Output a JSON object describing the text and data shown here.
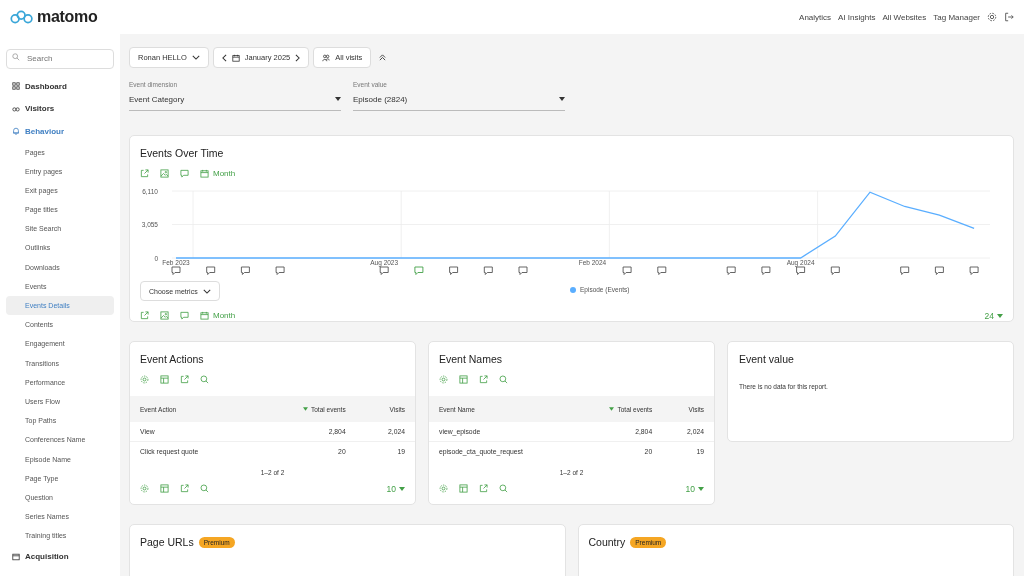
{
  "header": {
    "logo": "matomo",
    "nav": [
      "Analytics",
      "AI Insights",
      "All Websites",
      "Tag Manager"
    ]
  },
  "sidebar": {
    "search_placeholder": "Search",
    "sections": [
      {
        "label": "Dashboard",
        "kind": "grid",
        "selected": false
      },
      {
        "label": "Visitors",
        "kind": "glasses",
        "selected": false
      },
      {
        "label": "Behaviour",
        "kind": "bell",
        "selected": true,
        "children": [
          {
            "label": "Pages",
            "selected": false
          },
          {
            "label": "Entry pages",
            "selected": false
          },
          {
            "label": "Exit pages",
            "selected": false
          },
          {
            "label": "Page titles",
            "selected": false
          },
          {
            "label": "Site Search",
            "selected": false
          },
          {
            "label": "Outlinks",
            "selected": false
          },
          {
            "label": "Downloads",
            "selected": false
          },
          {
            "label": "Events",
            "selected": false
          },
          {
            "label": "Events Details",
            "selected": true
          },
          {
            "label": "Contents",
            "selected": false
          },
          {
            "label": "Engagement",
            "selected": false
          },
          {
            "label": "Transitions",
            "selected": false
          },
          {
            "label": "Performance",
            "selected": false
          },
          {
            "label": "Users Flow",
            "selected": false
          },
          {
            "label": "Top Paths",
            "selected": false
          },
          {
            "label": "Conferences Name",
            "selected": false
          },
          {
            "label": "Episode Name",
            "selected": false
          },
          {
            "label": "Page Type",
            "selected": false
          },
          {
            "label": "Question",
            "selected": false
          },
          {
            "label": "Series Names",
            "selected": false
          },
          {
            "label": "Training titles",
            "selected": false
          }
        ]
      },
      {
        "label": "Acquisition",
        "kind": "window",
        "selected": false
      }
    ]
  },
  "filters": {
    "site": "Ronan HELLO",
    "period": "January 2025",
    "segment": "All visits"
  },
  "dimension_fields": [
    {
      "label": "Event dimension",
      "value": "Event Category"
    },
    {
      "label": "Event value",
      "value": "Episode (2824)"
    }
  ],
  "evolution": {
    "title": "Events Over Time",
    "period": "Month",
    "bottom_period": "Month",
    "choose_metrics": "Choose metrics",
    "limit": "24",
    "annotation_slots": [
      {
        "kind": "comment",
        "selected": false
      },
      {
        "kind": "comment",
        "selected": false
      },
      {
        "kind": "comment",
        "selected": false
      },
      {
        "kind": "comment",
        "selected": false
      },
      {
        "kind": "empty"
      },
      {
        "kind": "empty"
      },
      {
        "kind": "comment",
        "selected": false
      },
      {
        "kind": "comment",
        "selected": true
      },
      {
        "kind": "comment",
        "selected": false
      },
      {
        "kind": "comment",
        "selected": false
      },
      {
        "kind": "comment",
        "selected": false
      },
      {
        "kind": "empty"
      },
      {
        "kind": "empty"
      },
      {
        "kind": "comment",
        "selected": false
      },
      {
        "kind": "comment",
        "selected": false
      },
      {
        "kind": "empty"
      },
      {
        "kind": "comment",
        "selected": false
      },
      {
        "kind": "comment",
        "selected": false
      },
      {
        "kind": "comment",
        "selected": false
      },
      {
        "kind": "comment",
        "selected": false
      },
      {
        "kind": "empty"
      },
      {
        "kind": "comment",
        "selected": false
      },
      {
        "kind": "comment",
        "selected": false
      },
      {
        "kind": "comment",
        "selected": false
      }
    ],
    "chart_data": {
      "type": "line",
      "categories": [
        "Feb 2023",
        null,
        null,
        null,
        null,
        null,
        "Aug 2023",
        null,
        null,
        null,
        null,
        null,
        "Feb 2024",
        null,
        null,
        null,
        null,
        null,
        "Aug 2024",
        null,
        null,
        null,
        null,
        null
      ],
      "series": [
        {
          "name": "Episode (Events)",
          "color": "#5aaeff",
          "values": [
            0,
            0,
            0,
            0,
            0,
            0,
            0,
            0,
            0,
            0,
            0,
            0,
            0,
            0,
            0,
            0,
            0,
            0,
            0,
            2000,
            6000,
            4700,
            3900,
            2700
          ]
        }
      ],
      "ylim": [
        0,
        6110
      ],
      "yticks": [
        {
          "value": 0,
          "label": "0"
        },
        {
          "value": 3055,
          "label": "3,055"
        },
        {
          "value": 6110,
          "label": "6,110"
        }
      ]
    }
  },
  "reports": [
    {
      "title": "Event Actions",
      "columns": [
        "Event Action",
        "Total events",
        "Visits"
      ],
      "rows": [
        [
          "View",
          "2,804",
          "2,024"
        ],
        [
          "Click request quote",
          "20",
          "19"
        ]
      ],
      "pagination": "1–2 of 2",
      "limit": "10"
    },
    {
      "title": "Event Names",
      "columns": [
        "Event Name",
        "Total events",
        "Visits"
      ],
      "rows": [
        [
          "view_episode",
          "2,804",
          "2,024"
        ],
        [
          "episode_cta_quote_request",
          "20",
          "19"
        ]
      ],
      "pagination": "1–2 of 2",
      "limit": "10"
    }
  ],
  "event_value": {
    "title": "Event value",
    "message": "There is no data for this report."
  },
  "premium_reports": [
    {
      "title": "Page URLs",
      "badge": "Premium"
    },
    {
      "title": "Country",
      "badge": "Premium"
    }
  ]
}
